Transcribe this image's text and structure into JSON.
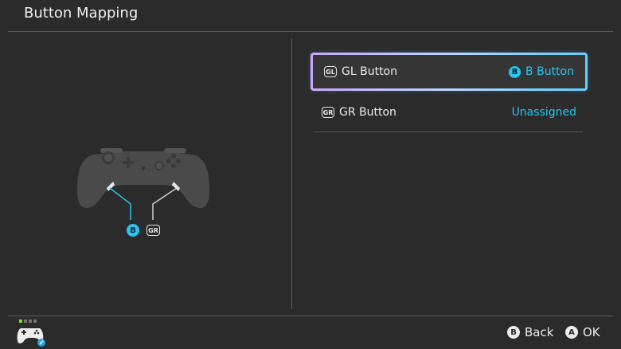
{
  "header": {
    "title": "Button Mapping"
  },
  "diagram": {
    "left_badge": "B",
    "right_badge": "GR"
  },
  "mappings": [
    {
      "key_icon": "GL",
      "label": "GL Button",
      "value_icon": "B",
      "value": "B Button",
      "selected": true
    },
    {
      "key_icon": "GR",
      "label": "GR Button",
      "value": "Unassigned",
      "selected": false
    }
  ],
  "footer": {
    "back": {
      "icon": "B",
      "label": "Back"
    },
    "ok": {
      "icon": "A",
      "label": "OK"
    }
  },
  "colors": {
    "accent": "#27c4f0",
    "background": "#2b2b2b"
  }
}
